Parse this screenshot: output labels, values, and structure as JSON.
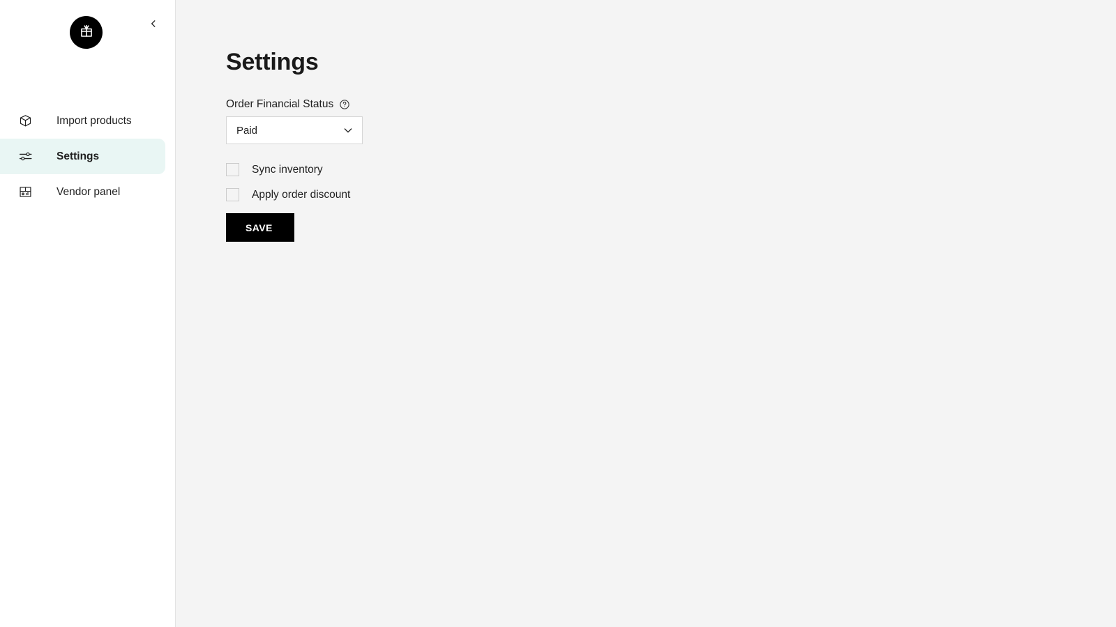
{
  "sidebar": {
    "logo_icon": "gift-icon",
    "collapse_icon": "chevron-left-icon",
    "items": [
      {
        "label": "Import products",
        "icon": "package-box-icon",
        "active": false
      },
      {
        "label": "Settings",
        "icon": "sliders-icon",
        "active": true
      },
      {
        "label": "Vendor panel",
        "icon": "panel-grid-icon",
        "active": false
      }
    ]
  },
  "main": {
    "title": "Settings",
    "financial_status": {
      "label": "Order Financial Status",
      "help_icon": "question-circle-icon",
      "selected": "Paid",
      "chevron_icon": "chevron-down-icon"
    },
    "checkboxes": [
      {
        "label": "Sync inventory",
        "checked": false
      },
      {
        "label": "Apply order discount",
        "checked": false
      }
    ],
    "save_label": "SAVE"
  },
  "colors": {
    "sidebar_bg": "#ffffff",
    "main_bg": "#f4f4f4",
    "active_nav_bg": "#e9f6f4",
    "accent_black": "#000000",
    "text": "#1f1f1f",
    "border": "#d6d6d6"
  }
}
